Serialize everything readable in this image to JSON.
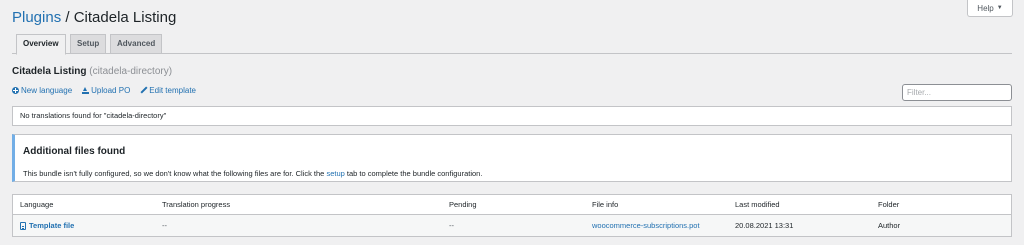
{
  "help": {
    "label": "Help",
    "caret": "▼"
  },
  "title": {
    "crumb": "Plugins",
    "separator": "/",
    "current": "Citadela Listing"
  },
  "tabs": [
    {
      "label": "Overview",
      "active": true
    },
    {
      "label": "Setup",
      "active": false
    },
    {
      "label": "Advanced",
      "active": false
    }
  ],
  "bundle": {
    "name": "Citadela Listing",
    "slug": "(citadela-directory)"
  },
  "actions": [
    {
      "label": "New language",
      "icon": "plus-circle-icon"
    },
    {
      "label": "Upload PO",
      "icon": "upload-icon"
    },
    {
      "label": "Edit template",
      "icon": "pencil-icon"
    }
  ],
  "filter": {
    "placeholder": "Filter..."
  },
  "notice": {
    "text": "No translations found for \"citadela-directory\""
  },
  "info": {
    "heading": "Additional files found",
    "text_before": "This bundle isn't fully configured, so we don't know what the following files are for. Click the",
    "link": "setup",
    "text_after": "tab to complete the bundle configuration."
  },
  "table": {
    "headers": [
      "Language",
      "Translation progress",
      "Pending",
      "File info",
      "Last modified",
      "Folder"
    ],
    "rows": [
      {
        "language": "Template file",
        "progress": "--",
        "pending": "--",
        "file": "woocommerce-subscriptions.pot",
        "modified": "20.08.2021 13:31",
        "folder": "Author"
      }
    ]
  },
  "colors": {
    "link": "#2271b1",
    "info_border": "#72aee6",
    "background": "#f0f0f1"
  }
}
